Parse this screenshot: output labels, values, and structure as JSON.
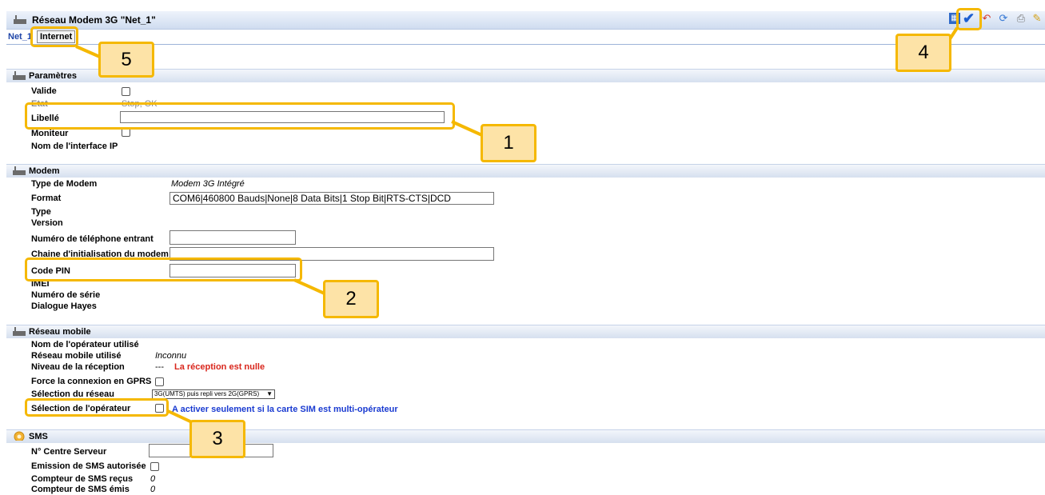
{
  "window": {
    "title": "Réseau Modem 3G \"Net_1\""
  },
  "tabs": {
    "net": "Net_1",
    "internet": "Internet"
  },
  "toolbar": {
    "icons": [
      "grid-icon",
      "validate-check-icon",
      "undo-icon",
      "refresh-icon",
      "print-icon",
      "tools-icon"
    ]
  },
  "parametres": {
    "title": "Paramètres",
    "valide": "Valide",
    "etat": "Etat",
    "etat_value": "Stop, OK",
    "libelle": "Libellé",
    "libelle_value": "",
    "moniteur": "Moniteur",
    "nom_interface": "Nom de l'interface IP"
  },
  "modem": {
    "title": "Modem",
    "type_modem": "Type de Modem",
    "type_modem_value": "Modem 3G Intégré",
    "format": "Format",
    "format_value": "COM6|460800 Bauds|None|8 Data Bits|1 Stop Bit|RTS-CTS|DCD",
    "type": "Type",
    "version": "Version",
    "numero_tel": "Numéro de téléphone entrant",
    "chaine_init": "Chaine d'initialisation du modem",
    "code_pin": "Code PIN",
    "imei": "IMEI",
    "numero_serie": "Numéro de série",
    "dialogue_hayes": "Dialogue Hayes"
  },
  "reseau": {
    "title": "Réseau mobile",
    "nom_operateur": "Nom de l'opérateur utilisé",
    "reseau_utilise": "Réseau mobile utilisé",
    "reseau_utilise_value": "Inconnu",
    "niveau": "Niveau de la réception",
    "niveau_value": "---",
    "niveau_alert": "La réception est nulle",
    "force_gprs": "Force la connexion en GPRS",
    "selection_reseau": "Sélection du réseau",
    "selection_reseau_value": "3G(UMTS) puis repli vers 2G(GPRS)",
    "selection_operateur": "Sélection de l'opérateur",
    "operateur_note": "A activer seulement si la carte SIM est multi-opérateur"
  },
  "sms": {
    "title": "SMS",
    "centre_serveur": "N° Centre Serveur",
    "emission": "Emission de SMS autorisée",
    "recus": "Compteur de SMS reçus",
    "recus_value": "0",
    "emis": "Compteur de SMS émis",
    "emis_value": "0"
  },
  "callouts": {
    "c1": "1",
    "c2": "2",
    "c3": "3",
    "c4": "4",
    "c5": "5"
  },
  "colors": {
    "accent": "#f5b800",
    "badge_fill": "#fde3a7",
    "alert": "#d9261c",
    "note": "#1a3bd1",
    "tab_active": "#2046a8"
  }
}
